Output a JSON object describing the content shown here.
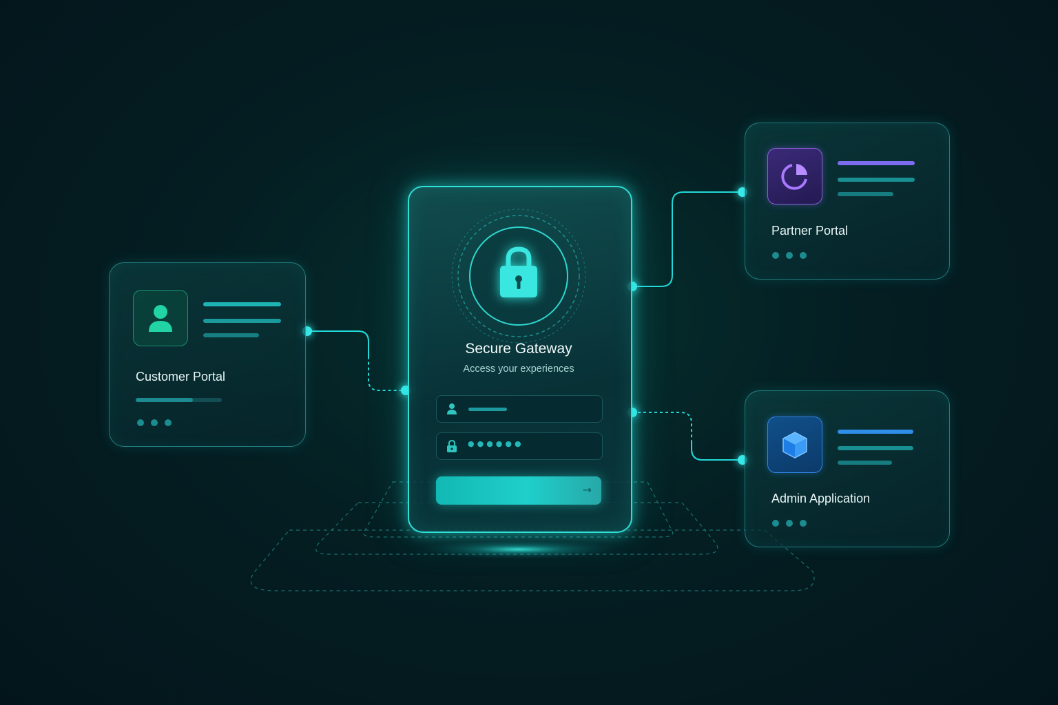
{
  "gateway": {
    "title": "Secure Gateway",
    "subtitle": "Access your experiences",
    "lock_icon": "padlock-icon",
    "username_icon": "user-icon",
    "password_icon": "lock-icon",
    "password_mask": "●●●●●●",
    "submit_icon": "arrow-right-icon"
  },
  "portals": [
    {
      "title": "Customer Portal",
      "icon": "user-icon",
      "accent": "#22d3a6"
    },
    {
      "title": "Partner Portal",
      "icon": "pie-chart-icon",
      "accent": "#a878ff"
    },
    {
      "title": "Admin Application",
      "icon": "cube-icon",
      "accent": "#2e9bff"
    }
  ],
  "colors": {
    "background": "#041e22",
    "glow": "#2fe0d6",
    "connector": "#23d9d9"
  }
}
